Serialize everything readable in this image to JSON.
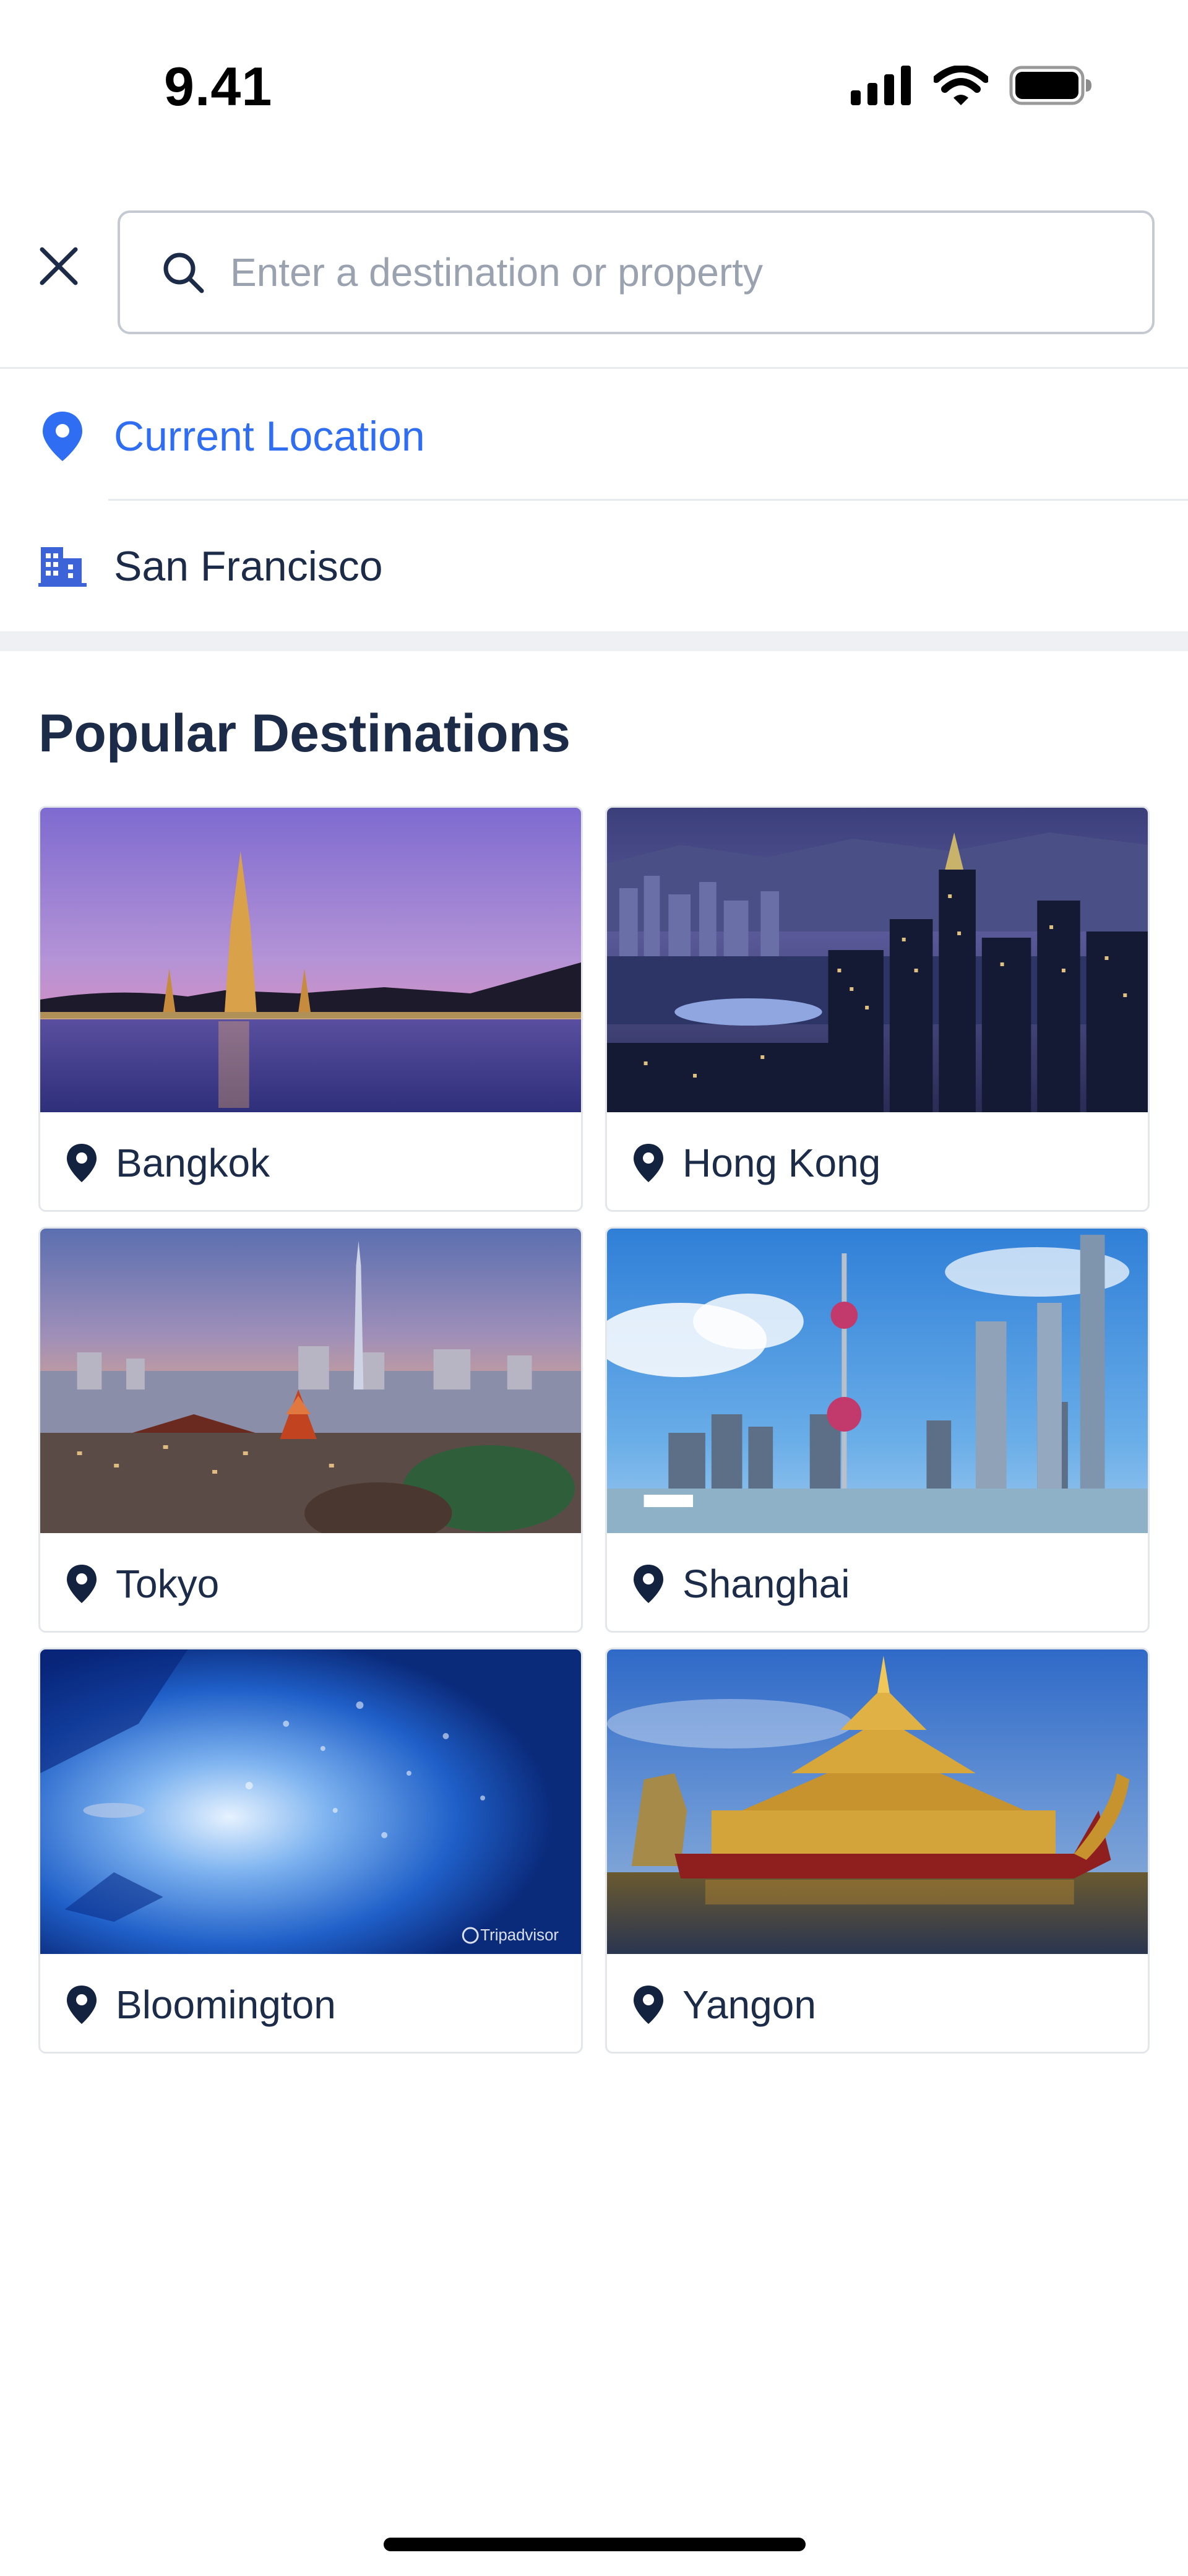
{
  "status_bar": {
    "time": "9.41",
    "icons": [
      "cellular-signal-icon",
      "wifi-icon",
      "battery-icon"
    ]
  },
  "search": {
    "close_icon": "close-icon",
    "search_icon": "search-icon",
    "placeholder": "Enter a destination or property",
    "value": ""
  },
  "suggestions": {
    "current_location": {
      "icon": "location-pin-icon",
      "label": "Current Location",
      "color": "#2f6ef2"
    },
    "city": {
      "icon": "building-icon",
      "label": "San Francisco"
    }
  },
  "popular": {
    "title": "Popular Destinations",
    "items": [
      {
        "name": "Bangkok",
        "icon": "location-pin-icon",
        "image": "bangkok-temple-sunset"
      },
      {
        "name": "Hong Kong",
        "icon": "location-pin-icon",
        "image": "hong-kong-night-skyline"
      },
      {
        "name": "Tokyo",
        "icon": "location-pin-icon",
        "image": "tokyo-skyline-dusk"
      },
      {
        "name": "Shanghai",
        "icon": "location-pin-icon",
        "image": "shanghai-pudong-skyline"
      },
      {
        "name": "Bloomington",
        "icon": "location-pin-icon",
        "image": "underwater-aquarium",
        "watermark": "Tripadvisor"
      },
      {
        "name": "Yangon",
        "icon": "location-pin-icon",
        "image": "yangon-golden-barge"
      }
    ]
  },
  "colors": {
    "primary_text": "#1b2b48",
    "accent": "#2f6ef2",
    "placeholder": "#9aa2b0",
    "divider": "#e7eaef"
  }
}
